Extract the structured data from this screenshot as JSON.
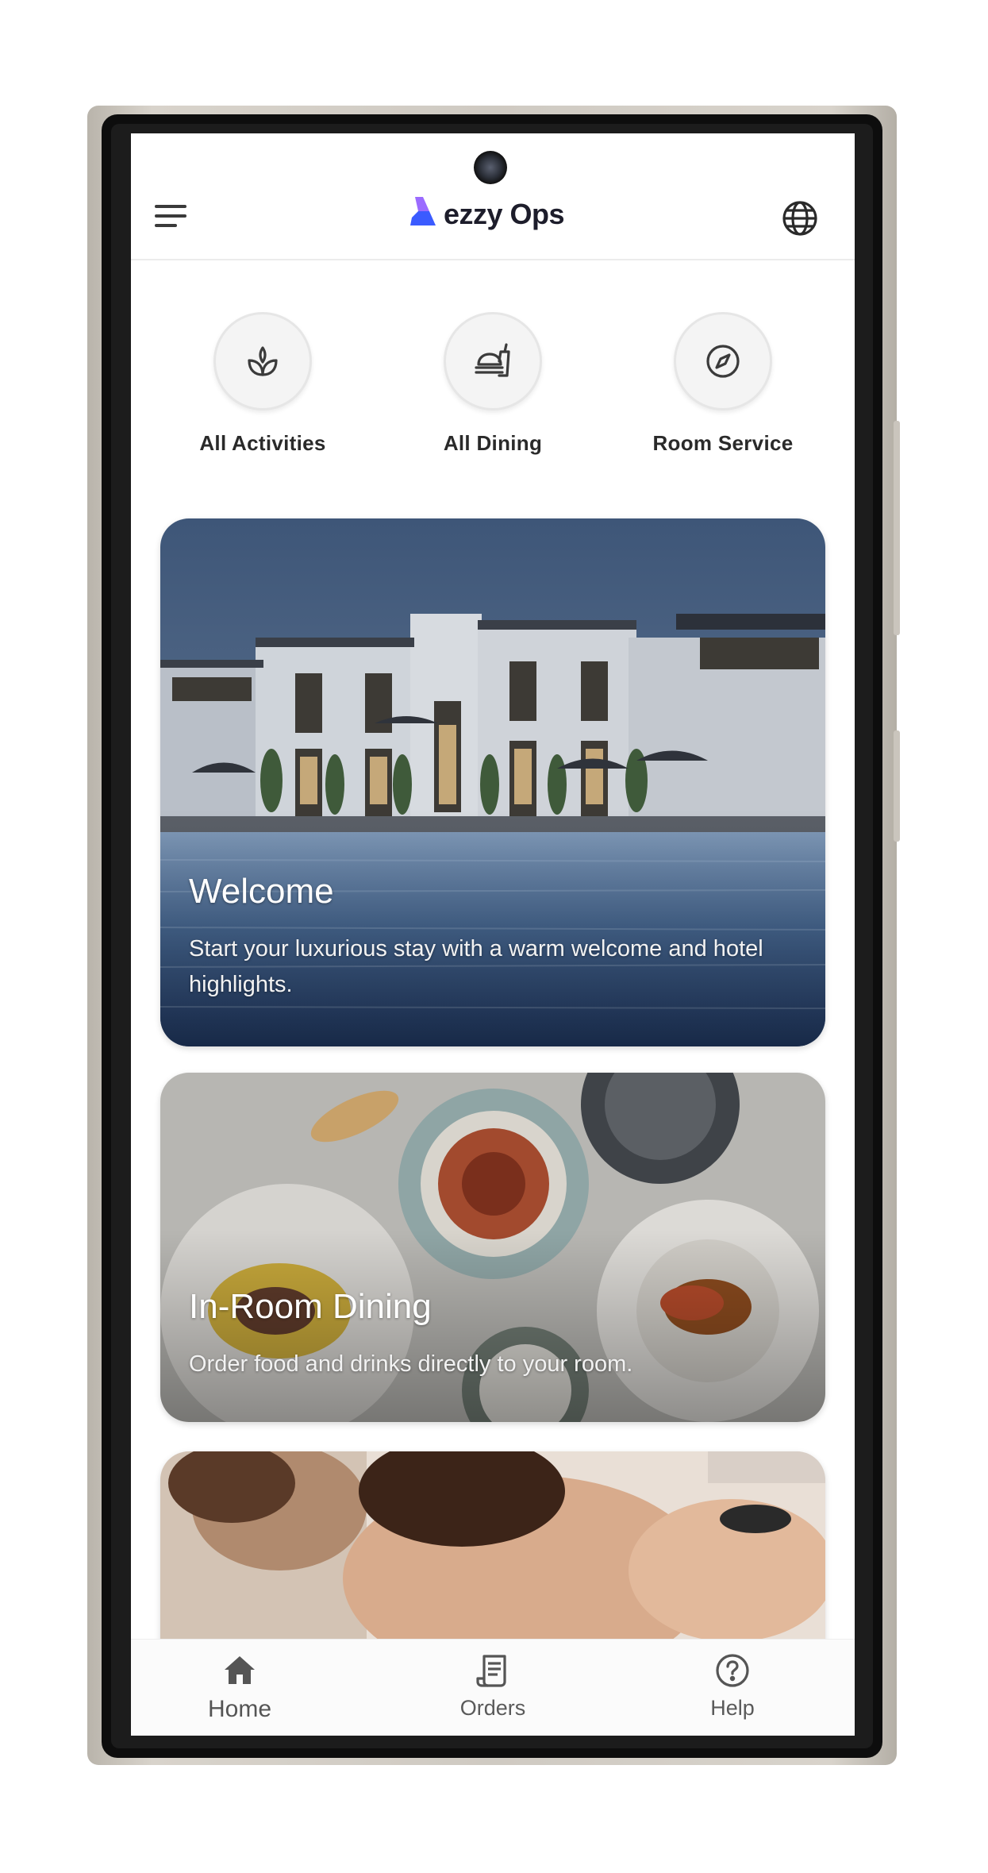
{
  "app": {
    "logo_text": "ezzy Ops"
  },
  "quick_actions": [
    {
      "label": "All Activities",
      "icon": "sprout-icon"
    },
    {
      "label": "All Dining",
      "icon": "dining-icon"
    },
    {
      "label": "Room Service",
      "icon": "compass-icon"
    }
  ],
  "cards": [
    {
      "title": "Welcome",
      "description": "Start your luxurious stay with a warm welcome and hotel highlights."
    },
    {
      "title": "In-Room Dining",
      "description": "Order food and drinks directly to your room."
    },
    {
      "title": "",
      "description": ""
    }
  ],
  "bottom_nav": [
    {
      "label": "Home",
      "icon": "home-icon",
      "active": true
    },
    {
      "label": "Orders",
      "icon": "receipt-icon",
      "active": false
    },
    {
      "label": "Help",
      "icon": "help-icon",
      "active": false
    }
  ],
  "colors": {
    "logo_blue": "#3b5bff",
    "logo_purple": "#8b5cf6",
    "text_dark": "#2a2a2a"
  }
}
